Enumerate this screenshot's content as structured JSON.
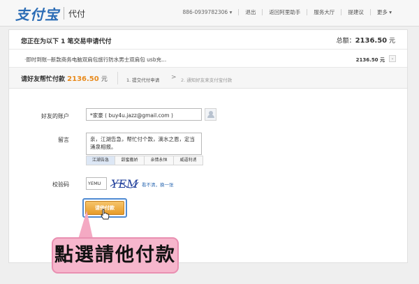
{
  "header": {
    "logo_text": "支付宝",
    "logo_sub": "代付",
    "nav": [
      "886-0939782306 ▾",
      "退出",
      "返回阿里助手",
      "服务大厅",
      "提建议",
      "更多 ▾"
    ]
  },
  "order": {
    "lead": "您正在为以下 1 笔交易申请代付",
    "total_label": "总额：",
    "total_value": "2136.50",
    "total_unit": " 元",
    "item_title": "·即时到账--新款商务电脑双肩包旅行防水男士双肩包 usb充...",
    "item_amount": "2136.50 元"
  },
  "ask": {
    "label": "请好友帮忙付款",
    "amount": "2136.50",
    "unit": "元",
    "step1": "1. 提交代付申请",
    "arrow": ">",
    "step2": "2. 通知好友来支付宝付款"
  },
  "form": {
    "account_label": "好友的账户",
    "account_value": "*家豪 ( buy4u.jazz@gmail.com )",
    "message_label": "留言",
    "message_value": "亲，江湖告急，帮忙付个款，滴水之恩，定当涌泉相报。",
    "templates": [
      "江湖告急",
      "甜蜜撒娇",
      "亲情永恒",
      "威逼利诱"
    ],
    "captcha_label": "校验码",
    "captcha_value": "YEMU",
    "captcha_image_text": "YEMU",
    "captcha_refresh": "看不清，换一张",
    "submit_label": "请他付款"
  },
  "callout": {
    "text": "點選請他付款"
  },
  "colors": {
    "accent_orange": "#e88a1c",
    "link_blue": "#2f6bb3",
    "callout_pink": "#f6b6cc"
  }
}
